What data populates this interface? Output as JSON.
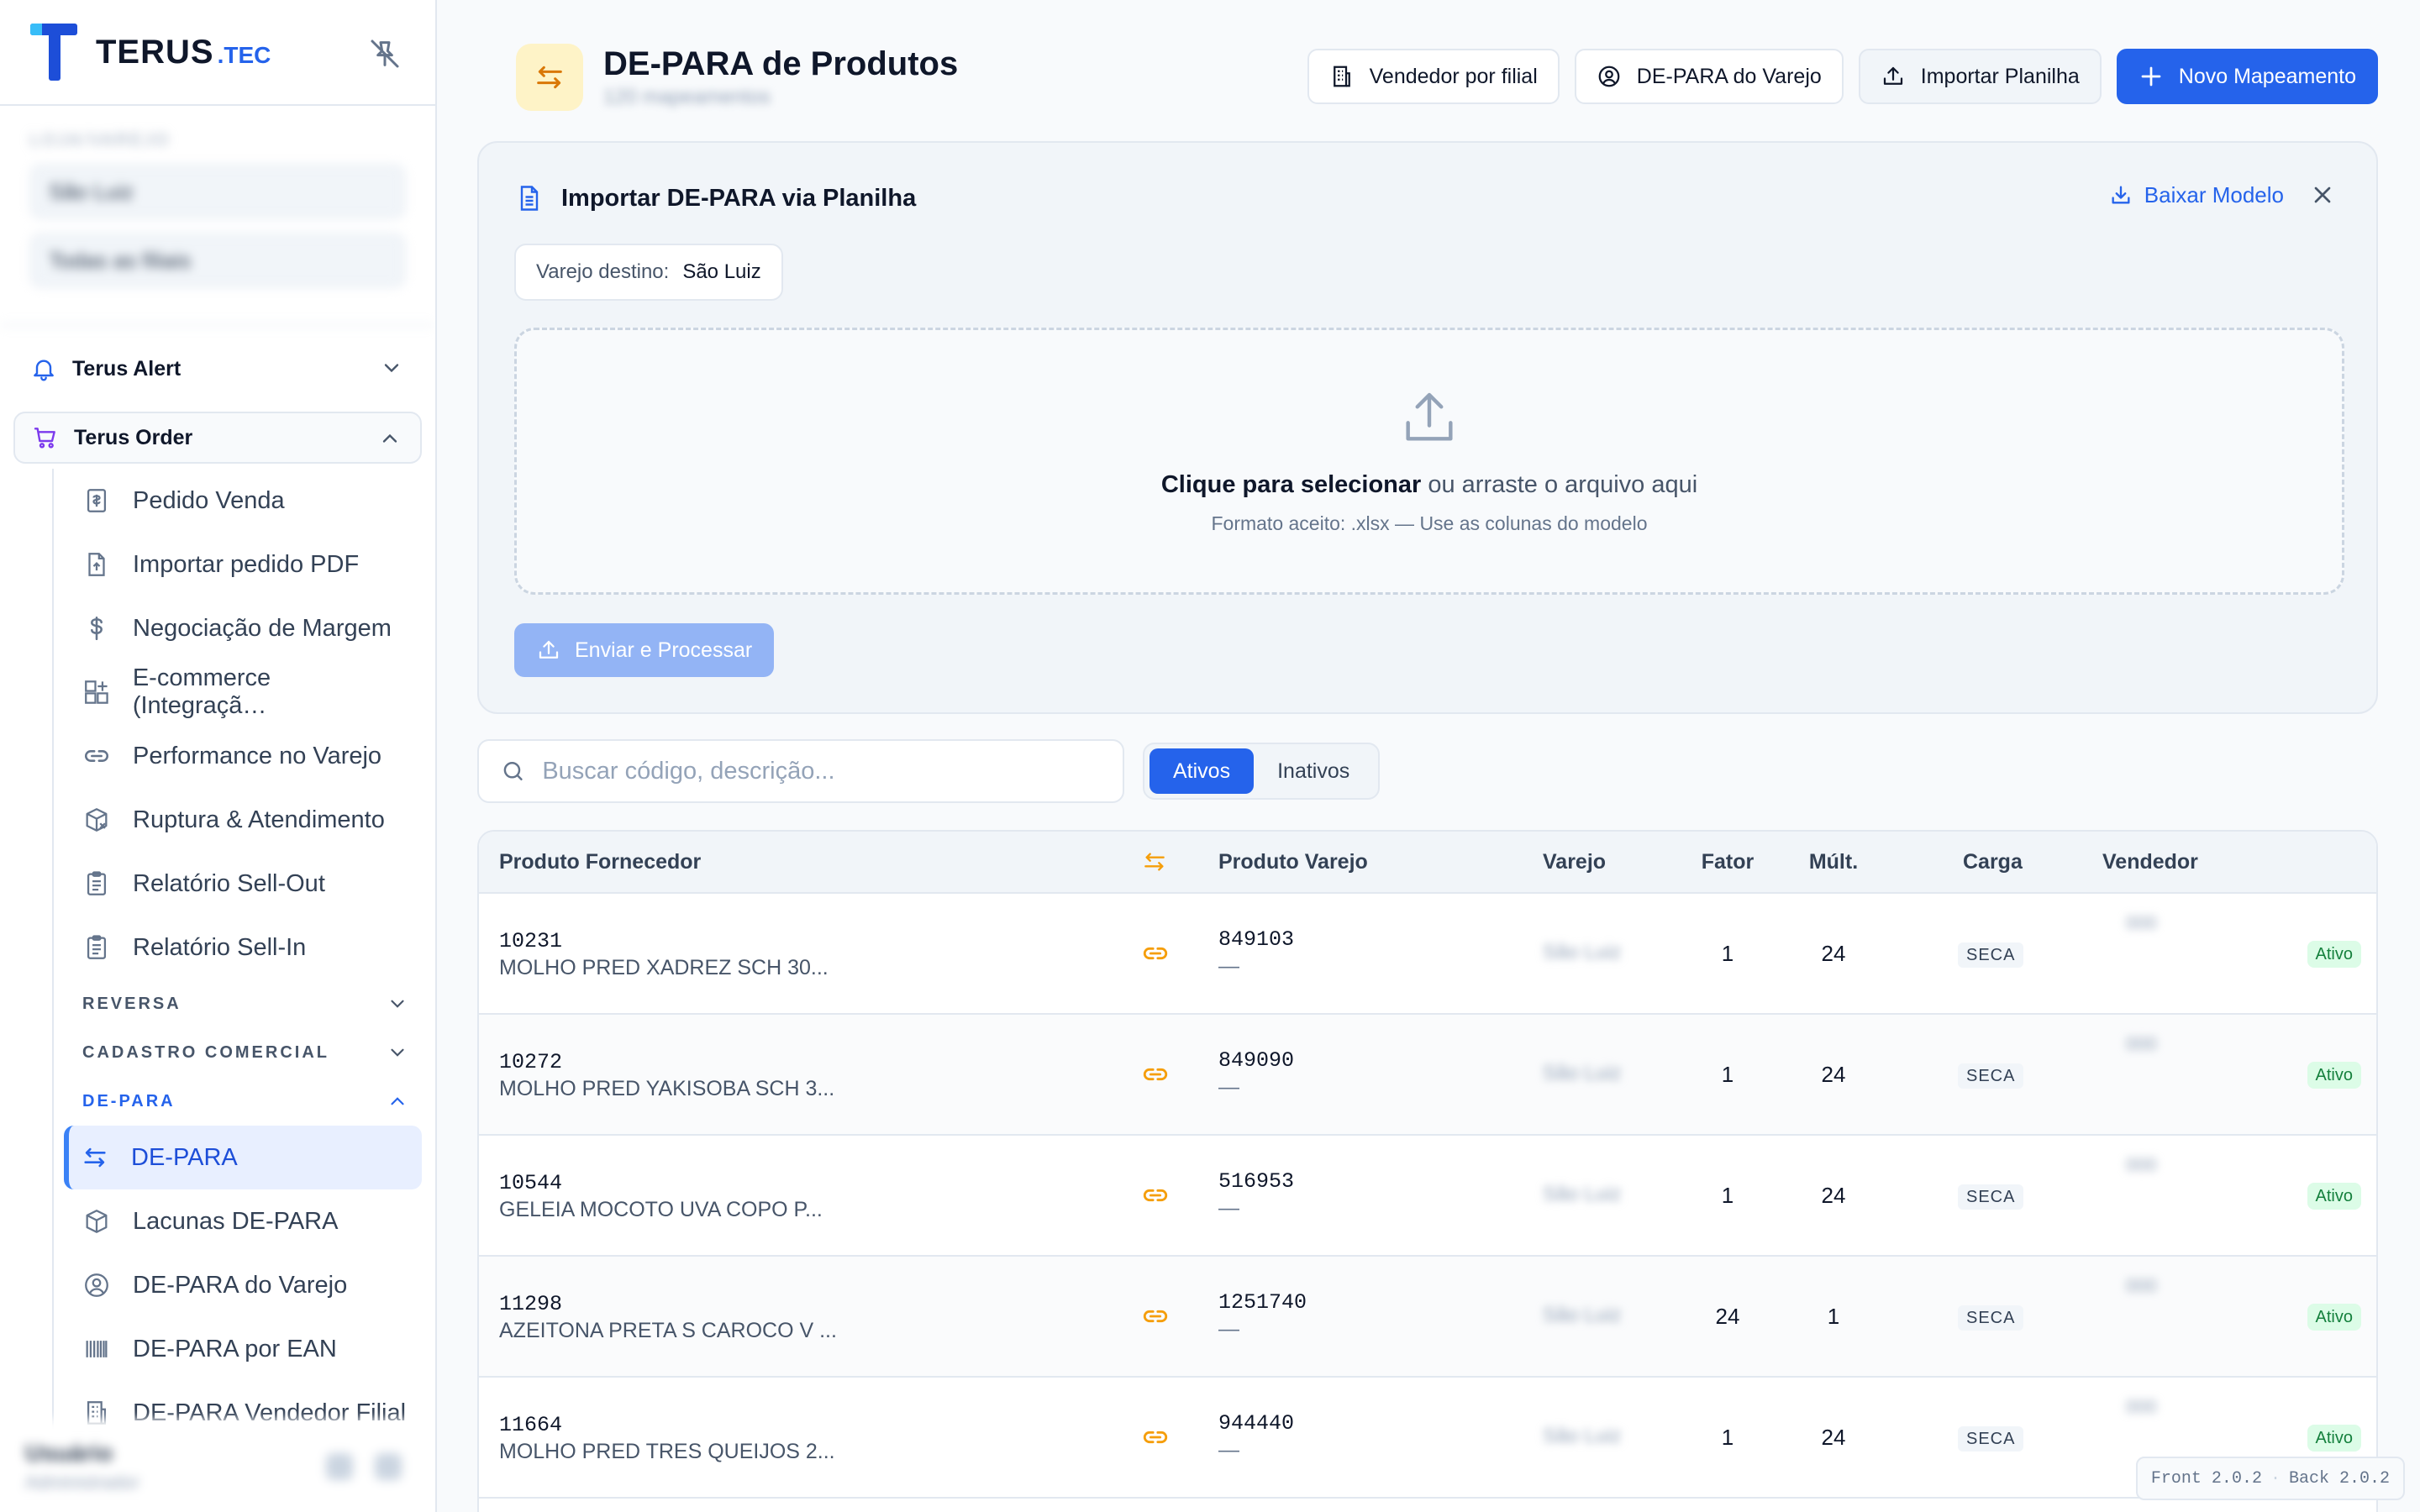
{
  "brand": {
    "name": "TERUS",
    "suffix": ".TEC"
  },
  "sidebar": {
    "filters": {
      "label": "LOJA/VAREJO",
      "select1": "São Luiz",
      "select2": "Todas as filiais"
    },
    "groups": [
      {
        "label": "Terus Alert"
      },
      {
        "label": "Terus Order"
      }
    ],
    "order_items": [
      {
        "label": "Pedido Venda",
        "icon": "receipt-icon"
      },
      {
        "label": "Importar pedido PDF",
        "icon": "file-upload-icon"
      },
      {
        "label": "Negociação de Margem",
        "icon": "dollar-icon"
      },
      {
        "label": "E-commerce (Integraçã…",
        "icon": "grid-plus-icon"
      },
      {
        "label": "Performance no Varejo",
        "icon": "link-icon"
      },
      {
        "label": "Ruptura & Atendimento",
        "icon": "box-x-icon"
      },
      {
        "label": "Relatório Sell-Out",
        "icon": "clipboard-icon"
      },
      {
        "label": "Relatório Sell-In",
        "icon": "clipboard-icon"
      }
    ],
    "sections": {
      "reversa": "REVERSA",
      "cadastro": "CADASTRO COMERCIAL",
      "depara": "DE-PARA"
    },
    "depara_items": [
      {
        "label": "DE-PARA",
        "icon": "arrows-swap-icon"
      },
      {
        "label": "Lacunas DE-PARA",
        "icon": "cube-icon"
      },
      {
        "label": "DE-PARA do Varejo",
        "icon": "user-circle-icon"
      },
      {
        "label": "DE-PARA por EAN",
        "icon": "barcode-icon"
      },
      {
        "label": "DE-PARA Vendedor Filial",
        "icon": "building-icon"
      }
    ],
    "user": {
      "name": "Usuário",
      "role": "Administrador"
    }
  },
  "header": {
    "title": "DE-PARA de Produtos",
    "subtitle": "120 mapeamentos",
    "buttons": {
      "vendedor": "Vendedor por filial",
      "depara_varejo": "DE-PARA do Varejo",
      "importar": "Importar Planilha",
      "novo": "Novo Mapeamento"
    }
  },
  "import_panel": {
    "title": "Importar DE-PARA via Planilha",
    "download": "Baixar Modelo",
    "dest_label": "Varejo destino:",
    "dest_value": "São Luiz",
    "drop_strong": "Clique para selecionar",
    "drop_rest": " ou arraste o arquivo aqui",
    "drop_hint": "Formato aceito: .xlsx — Use as colunas do modelo",
    "submit": "Enviar e Processar"
  },
  "search": {
    "placeholder": "Buscar código, descrição..."
  },
  "status_filter": {
    "active": "Ativos",
    "inactive": "Inativos"
  },
  "table": {
    "columns": {
      "fornecedor": "Produto Fornecedor",
      "varejo_prod": "Produto Varejo",
      "varejo": "Varejo",
      "fator": "Fator",
      "mult": "Múlt.",
      "carga": "Carga",
      "vendedor": "Vendedor"
    },
    "rows": [
      {
        "code": "10231",
        "desc": "MOLHO PRED XADREZ SCH 30...",
        "vcode": "849103",
        "vdesc": "—",
        "varejo": "São Luiz",
        "fator": "1",
        "mult": "24",
        "carga": "SECA",
        "vendedor": "000",
        "status": "Ativo"
      },
      {
        "code": "10272",
        "desc": "MOLHO PRED YAKISOBA SCH 3...",
        "vcode": "849090",
        "vdesc": "—",
        "varejo": "São Luiz",
        "fator": "1",
        "mult": "24",
        "carga": "SECA",
        "vendedor": "000",
        "status": "Ativo"
      },
      {
        "code": "10544",
        "desc": "GELEIA MOCOTO UVA COPO P...",
        "vcode": "516953",
        "vdesc": "—",
        "varejo": "São Luiz",
        "fator": "1",
        "mult": "24",
        "carga": "SECA",
        "vendedor": "000",
        "status": "Ativo"
      },
      {
        "code": "11298",
        "desc": "AZEITONA PRETA S CAROCO V ...",
        "vcode": "1251740",
        "vdesc": "—",
        "varejo": "São Luiz",
        "fator": "24",
        "mult": "1",
        "carga": "SECA",
        "vendedor": "000",
        "status": "Ativo"
      },
      {
        "code": "11664",
        "desc": "MOLHO PRED TRES QUEIJOS 2...",
        "vcode": "944440",
        "vdesc": "—",
        "varejo": "São Luiz",
        "fator": "1",
        "mult": "24",
        "carga": "SECA",
        "vendedor": "000",
        "status": "Ativo"
      }
    ]
  },
  "version": {
    "front": "Front 2.0.2",
    "back": "Back 2.0.2"
  },
  "colors": {
    "primary": "#2563eb",
    "accent": "#f59e0b",
    "success": "#15803d"
  }
}
